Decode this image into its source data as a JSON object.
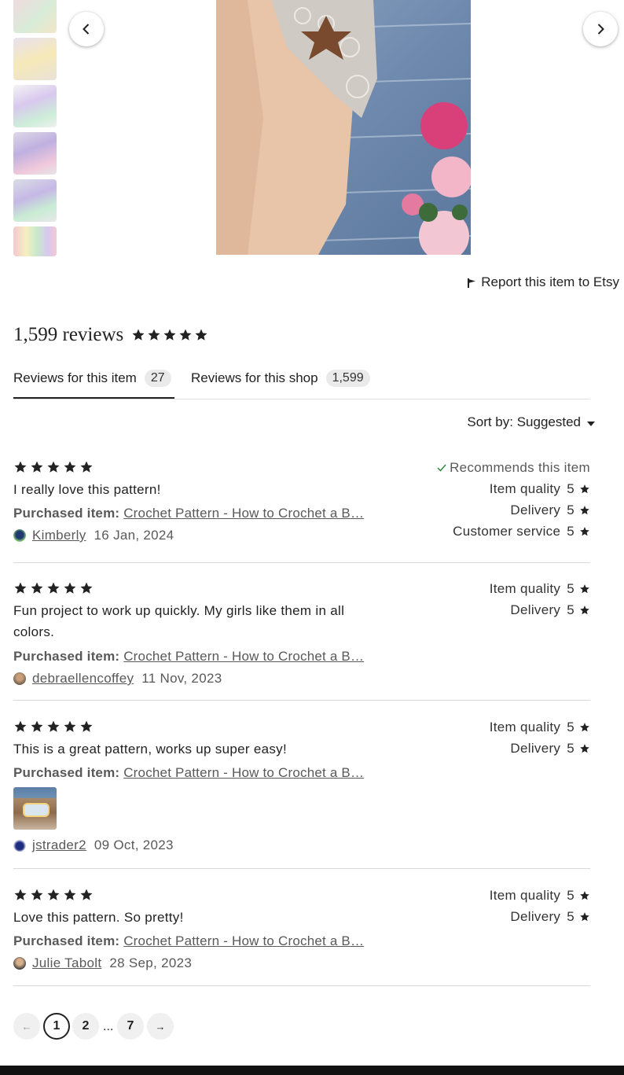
{
  "gallery": {
    "prev_label": "Previous image",
    "next_label": "Next image",
    "report_link": "Report this item to Etsy"
  },
  "reviews_header": {
    "count_label": "1,599 reviews",
    "rating": 5
  },
  "tabs": [
    {
      "label": "Reviews for this item",
      "count": "27",
      "active": true
    },
    {
      "label": "Reviews for this shop",
      "count": "1,599",
      "active": false
    }
  ],
  "sort": {
    "label": "Sort by: Suggested"
  },
  "reviews": [
    {
      "stars": 5,
      "text": "I really love this pattern!",
      "purchased_prefix": "Purchased item:",
      "purchased_item": "Crochet Pattern - How to Crochet a B…",
      "reviewer": "Kimberly",
      "date": "16 Jan, 2024",
      "recommends": "Recommends this item",
      "ratings": [
        {
          "label": "Item quality",
          "value": "5"
        },
        {
          "label": "Delivery",
          "value": "5"
        },
        {
          "label": "Customer service",
          "value": "5"
        }
      ]
    },
    {
      "stars": 5,
      "text": "Fun project to work up quickly. My girls like them in all colors.",
      "purchased_prefix": "Purchased item:",
      "purchased_item": "Crochet Pattern - How to Crochet a B…",
      "reviewer": "debraellencoffey",
      "date": "11 Nov, 2023",
      "ratings": [
        {
          "label": "Item quality",
          "value": "5"
        },
        {
          "label": "Delivery",
          "value": "5"
        }
      ]
    },
    {
      "stars": 5,
      "text": "This is a great pattern, works up super easy!",
      "purchased_prefix": "Purchased item:",
      "purchased_item": "Crochet Pattern - How to Crochet a B…",
      "reviewer": "jstrader2",
      "date": "09 Oct, 2023",
      "ratings": [
        {
          "label": "Item quality",
          "value": "5"
        },
        {
          "label": "Delivery",
          "value": "5"
        }
      ]
    },
    {
      "stars": 5,
      "text": "Love this pattern. So pretty!",
      "purchased_prefix": "Purchased item:",
      "purchased_item": "Crochet Pattern - How to Crochet a B…",
      "reviewer": "Julie Tabolt",
      "date": "28 Sep, 2023",
      "ratings": [
        {
          "label": "Item quality",
          "value": "5"
        },
        {
          "label": "Delivery",
          "value": "5"
        }
      ]
    }
  ],
  "pagination": {
    "prev": "←",
    "pages": [
      "1",
      "2"
    ],
    "ellipsis": "...",
    "last": "7",
    "next": "→"
  },
  "colors": {
    "text": "#222222",
    "muted": "#595959",
    "check": "#2b8a3e"
  }
}
